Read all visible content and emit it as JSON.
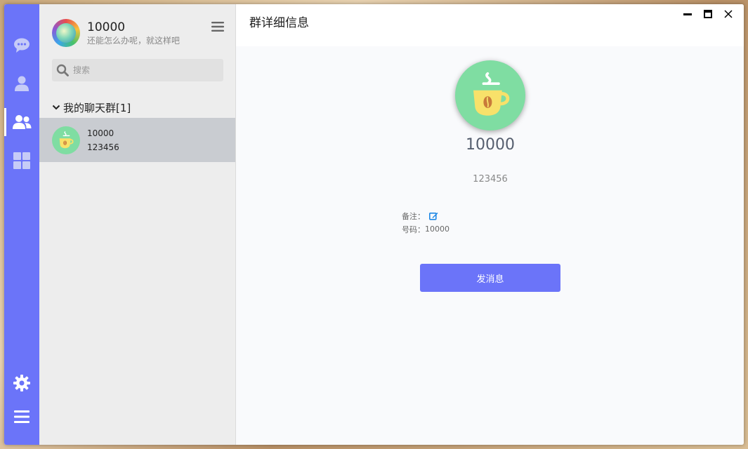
{
  "colors": {
    "accent": "#6b74f9",
    "rail_icon": "#c6cbf7",
    "group_avatar_bg": "#7fdda2",
    "selected_row": "#c9ccd1"
  },
  "rail": {
    "items": [
      {
        "icon": "chat-icon",
        "active": false
      },
      {
        "icon": "user-icon",
        "active": false
      },
      {
        "icon": "group-icon",
        "active": true
      },
      {
        "icon": "apps-icon",
        "active": false
      }
    ],
    "bottom": [
      {
        "icon": "gear-icon"
      },
      {
        "icon": "hamburger-menu-icon"
      }
    ]
  },
  "profile": {
    "name": "10000",
    "signature": "还能怎么办呢，就这样吧"
  },
  "search": {
    "placeholder": "搜索",
    "value": ""
  },
  "group_list": {
    "header": "我的聊天群[1]",
    "items": [
      {
        "name": "10000",
        "id": "123456"
      }
    ]
  },
  "detail": {
    "title": "群详细信息",
    "name": "10000",
    "id": "123456",
    "remark_label": "备注：",
    "number_label": "号码：",
    "number_value": "10000",
    "send_button": "发消息"
  }
}
